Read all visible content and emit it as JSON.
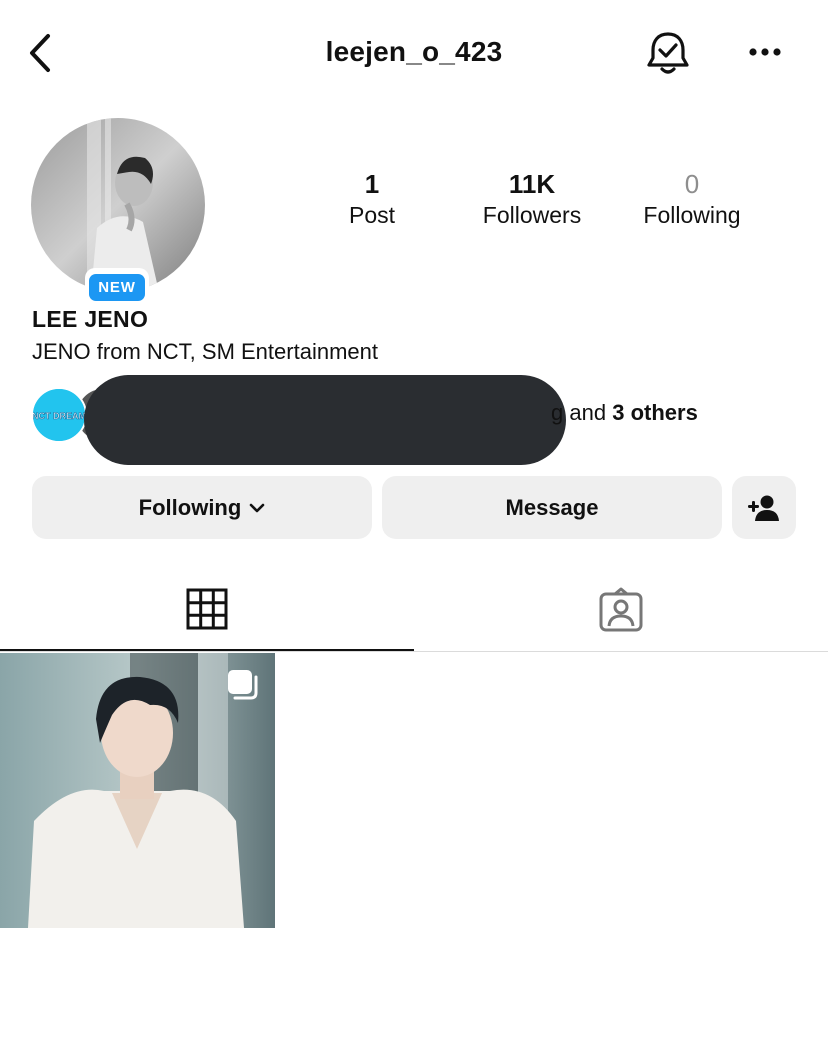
{
  "header": {
    "username": "leejen_o_423",
    "back_icon": "chevron-left-icon",
    "bell_icon": "bell-check-icon",
    "more_icon": "more-horizontal-icon"
  },
  "profile": {
    "badge": "NEW",
    "name": "LEE JENO",
    "bio": "JENO from NCT, SM Entertainment"
  },
  "stats": [
    {
      "value": "1",
      "label": "Post"
    },
    {
      "value": "11K",
      "label": "Followers"
    },
    {
      "value": "0",
      "label": "Following"
    }
  ],
  "followed_by": {
    "mini_avatar_text": "NCT DREAM",
    "visible_fragment": "g",
    "and_text": "and",
    "others_text": "3 others"
  },
  "actions": {
    "following_label": "Following",
    "message_label": "Message"
  },
  "tabs": [
    {
      "name": "posts-grid",
      "icon": "grid-icon",
      "active": true
    },
    {
      "name": "tagged",
      "icon": "tagged-user-icon",
      "active": false
    }
  ],
  "colors": {
    "badge_blue": "#1c97f3",
    "button_bg": "#efefef",
    "redaction": "#2a2d31",
    "muted_text": "#8e8e8e"
  }
}
